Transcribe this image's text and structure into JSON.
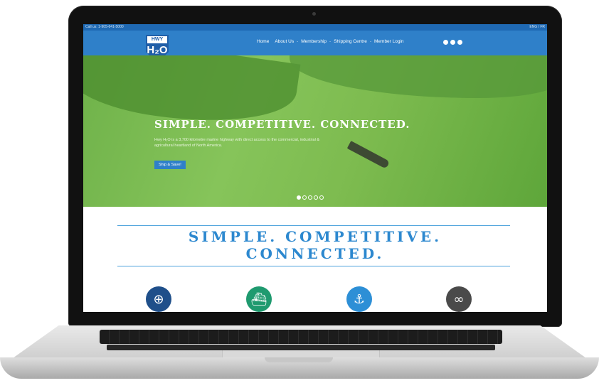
{
  "topbar": {
    "call": "Call us: 1-905-641-5000",
    "lang": "ENG / FR"
  },
  "logo": {
    "top": "HWY",
    "main": "H₂O"
  },
  "nav": {
    "items": [
      "Home",
      "About Us",
      "Membership",
      "Shipping Centre",
      "Member Login"
    ]
  },
  "hero": {
    "headline": "SIMPLE. COMPETITIVE. CONNECTED.",
    "body": "Hwy H₂O is a 3,700 kilometre marine highway with direct access to the commercial, industrial & agricultural heartland of North America.",
    "button": "Ship & Save!"
  },
  "section": {
    "headline_line1": "SIMPLE. COMPETITIVE.",
    "headline_line2": "CONNECTED."
  },
  "feature_icons": [
    {
      "icon": "globe-icon",
      "color": "#1f4f8a"
    },
    {
      "icon": "ship-icon",
      "color": "#1f9a6f"
    },
    {
      "icon": "crane-icon",
      "color": "#2d8fd6"
    },
    {
      "icon": "link-icon",
      "color": "#4a4a4a"
    }
  ]
}
